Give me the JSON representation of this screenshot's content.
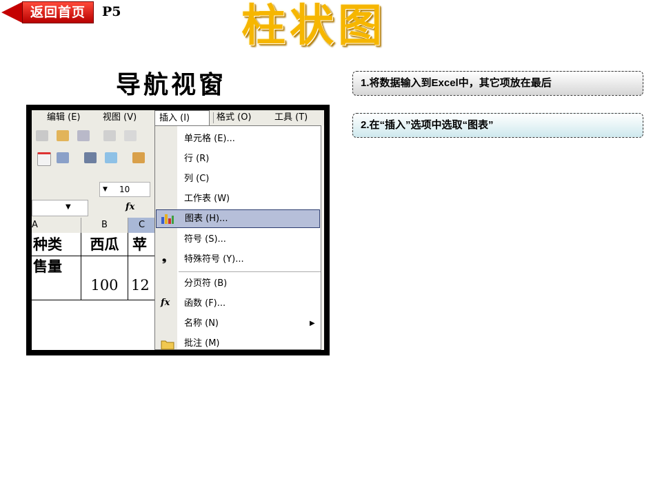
{
  "nav": {
    "back_label": "返回首页",
    "page_label": "P5"
  },
  "title": "柱状图",
  "subtitle": "导航视窗",
  "steps": [
    "1.将数据输入到Excel中，其它项放在最后",
    "2.在“插入”选项中选取“图表”"
  ],
  "excel": {
    "menu": {
      "edit": "编辑 (E)",
      "view": "视图 (V)",
      "insert": "插入 (I)",
      "format": "格式 (O)",
      "tools": "工具 (T)"
    },
    "font_size": "10",
    "fx": "fx",
    "columns": [
      "A",
      "B",
      "C"
    ],
    "rows": [
      [
        "种类",
        "西瓜",
        "苹"
      ],
      [
        "售量",
        "100",
        "12"
      ]
    ],
    "insert_menu": [
      {
        "label": "单元格 (E)...",
        "icon": ""
      },
      {
        "label": "行 (R)",
        "icon": ""
      },
      {
        "label": "列 (C)",
        "icon": ""
      },
      {
        "label": "工作表 (W)",
        "icon": ""
      },
      {
        "label": "图表 (H)...",
        "icon": "chart-icon",
        "highlighted": true
      },
      {
        "label": "符号 (S)...",
        "icon": ""
      },
      {
        "label": "特殊符号 (Y)...",
        "icon": "comma-icon"
      },
      {
        "label": "分页符 (B)",
        "icon": ""
      },
      {
        "label": "函数 (F)...",
        "icon": "fx-icon"
      },
      {
        "label": "名称 (N)",
        "icon": "",
        "submenu": true
      },
      {
        "label": "批注 (M)",
        "icon": "folder-icon"
      }
    ]
  }
}
